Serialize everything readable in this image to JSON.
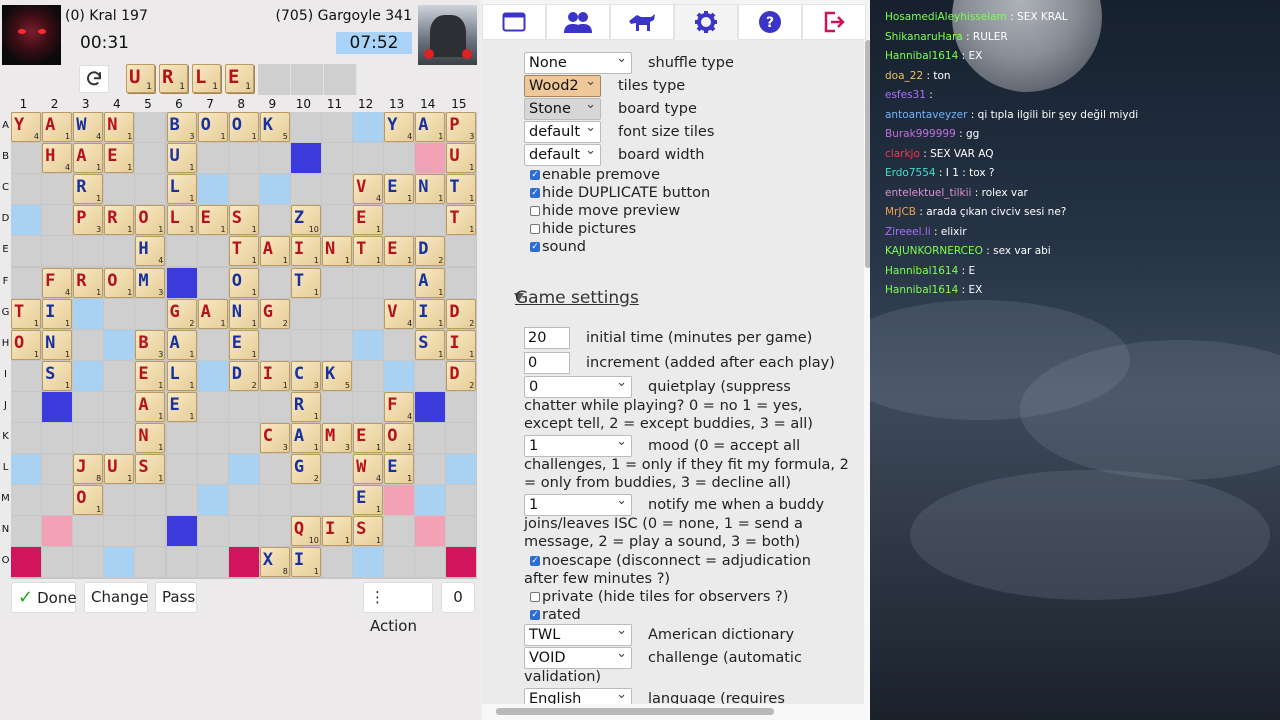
{
  "players": {
    "p1": {
      "name": "(0) Kral 197",
      "clock": "00:31"
    },
    "p2": {
      "name": "(705) Gargoyle 341",
      "clock": "07:52"
    }
  },
  "rack": [
    {
      "letter": "U",
      "value": "1"
    },
    {
      "letter": "R",
      "value": "1"
    },
    {
      "letter": "L",
      "value": "1"
    },
    {
      "letter": "E",
      "value": "1"
    }
  ],
  "board": {
    "columns": [
      "1",
      "2",
      "3",
      "4",
      "5",
      "6",
      "7",
      "8",
      "9",
      "10",
      "11",
      "12",
      "13",
      "14",
      "15"
    ],
    "rows": [
      "A",
      "B",
      "C",
      "D",
      "E",
      "F",
      "G",
      "H",
      "I",
      "J",
      "K",
      "L",
      "M",
      "N",
      "O"
    ],
    "tiles": [
      {
        "r": 0,
        "c": 0,
        "l": "Y",
        "v": "4"
      },
      {
        "r": 0,
        "c": 1,
        "l": "A",
        "v": "1"
      },
      {
        "r": 0,
        "c": 2,
        "l": "W",
        "v": "4",
        "b": true
      },
      {
        "r": 0,
        "c": 3,
        "l": "N",
        "v": "1"
      },
      {
        "r": 0,
        "c": 5,
        "l": "B",
        "v": "3",
        "b": true
      },
      {
        "r": 0,
        "c": 6,
        "l": "O",
        "v": "1",
        "b": true
      },
      {
        "r": 0,
        "c": 7,
        "l": "O",
        "v": "1",
        "b": true
      },
      {
        "r": 0,
        "c": 8,
        "l": "K",
        "v": "5",
        "b": true
      },
      {
        "r": 0,
        "c": 12,
        "l": "Y",
        "v": "4",
        "b": true
      },
      {
        "r": 0,
        "c": 13,
        "l": "A",
        "v": "1",
        "b": true
      },
      {
        "r": 0,
        "c": 14,
        "l": "P",
        "v": "3"
      },
      {
        "r": 1,
        "c": 1,
        "l": "H",
        "v": "4"
      },
      {
        "r": 1,
        "c": 2,
        "l": "A",
        "v": "1"
      },
      {
        "r": 1,
        "c": 3,
        "l": "E",
        "v": "1"
      },
      {
        "r": 1,
        "c": 5,
        "l": "U",
        "v": "1",
        "b": true
      },
      {
        "r": 1,
        "c": 14,
        "l": "U",
        "v": "1"
      },
      {
        "r": 2,
        "c": 2,
        "l": "R",
        "v": "1",
        "b": true
      },
      {
        "r": 2,
        "c": 5,
        "l": "L",
        "v": "1",
        "b": true
      },
      {
        "r": 2,
        "c": 11,
        "l": "V",
        "v": "4"
      },
      {
        "r": 2,
        "c": 12,
        "l": "E",
        "v": "1",
        "b": true
      },
      {
        "r": 2,
        "c": 13,
        "l": "N",
        "v": "1",
        "b": true
      },
      {
        "r": 2,
        "c": 14,
        "l": "T",
        "v": "1",
        "b": true
      },
      {
        "r": 3,
        "c": 2,
        "l": "P",
        "v": "3"
      },
      {
        "r": 3,
        "c": 3,
        "l": "R",
        "v": "1"
      },
      {
        "r": 3,
        "c": 4,
        "l": "O",
        "v": "1"
      },
      {
        "r": 3,
        "c": 5,
        "l": "L",
        "v": "1"
      },
      {
        "r": 3,
        "c": 6,
        "l": "E",
        "v": "1"
      },
      {
        "r": 3,
        "c": 7,
        "l": "S",
        "v": "1"
      },
      {
        "r": 3,
        "c": 9,
        "l": "Z",
        "v": "10",
        "b": true
      },
      {
        "r": 3,
        "c": 11,
        "l": "E",
        "v": "1"
      },
      {
        "r": 3,
        "c": 14,
        "l": "T",
        "v": "1"
      },
      {
        "r": 4,
        "c": 4,
        "l": "H",
        "v": "4",
        "b": true
      },
      {
        "r": 4,
        "c": 7,
        "l": "T",
        "v": "1"
      },
      {
        "r": 4,
        "c": 8,
        "l": "A",
        "v": "1"
      },
      {
        "r": 4,
        "c": 9,
        "l": "I",
        "v": "1"
      },
      {
        "r": 4,
        "c": 10,
        "l": "N",
        "v": "1"
      },
      {
        "r": 4,
        "c": 11,
        "l": "T",
        "v": "1"
      },
      {
        "r": 4,
        "c": 12,
        "l": "E",
        "v": "1"
      },
      {
        "r": 4,
        "c": 13,
        "l": "D",
        "v": "2",
        "b": true
      },
      {
        "r": 5,
        "c": 1,
        "l": "F",
        "v": "4"
      },
      {
        "r": 5,
        "c": 2,
        "l": "R",
        "v": "1"
      },
      {
        "r": 5,
        "c": 3,
        "l": "O",
        "v": "1"
      },
      {
        "r": 5,
        "c": 4,
        "l": "M",
        "v": "3",
        "b": true
      },
      {
        "r": 5,
        "c": 7,
        "l": "O",
        "v": "1",
        "b": true
      },
      {
        "r": 5,
        "c": 9,
        "l": "T",
        "v": "1",
        "b": true
      },
      {
        "r": 5,
        "c": 13,
        "l": "A",
        "v": "1",
        "b": true
      },
      {
        "r": 6,
        "c": 0,
        "l": "T",
        "v": "1"
      },
      {
        "r": 6,
        "c": 1,
        "l": "I",
        "v": "1",
        "b": true
      },
      {
        "r": 6,
        "c": 5,
        "l": "G",
        "v": "2"
      },
      {
        "r": 6,
        "c": 6,
        "l": "A",
        "v": "1"
      },
      {
        "r": 6,
        "c": 7,
        "l": "N",
        "v": "1",
        "b": true
      },
      {
        "r": 6,
        "c": 8,
        "l": "G",
        "v": "2"
      },
      {
        "r": 6,
        "c": 12,
        "l": "V",
        "v": "4"
      },
      {
        "r": 6,
        "c": 13,
        "l": "I",
        "v": "1",
        "b": true
      },
      {
        "r": 6,
        "c": 14,
        "l": "D",
        "v": "2"
      },
      {
        "r": 7,
        "c": 0,
        "l": "O",
        "v": "1"
      },
      {
        "r": 7,
        "c": 1,
        "l": "N",
        "v": "1",
        "b": true
      },
      {
        "r": 7,
        "c": 4,
        "l": "B",
        "v": "3"
      },
      {
        "r": 7,
        "c": 5,
        "l": "A",
        "v": "1",
        "b": true
      },
      {
        "r": 7,
        "c": 7,
        "l": "E",
        "v": "1",
        "b": true
      },
      {
        "r": 7,
        "c": 13,
        "l": "S",
        "v": "1",
        "b": true
      },
      {
        "r": 7,
        "c": 14,
        "l": "I",
        "v": "1"
      },
      {
        "r": 8,
        "c": 1,
        "l": "S",
        "v": "1",
        "b": true
      },
      {
        "r": 8,
        "c": 4,
        "l": "E",
        "v": "1"
      },
      {
        "r": 8,
        "c": 5,
        "l": "L",
        "v": "1",
        "b": true
      },
      {
        "r": 8,
        "c": 7,
        "l": "D",
        "v": "2",
        "b": true
      },
      {
        "r": 8,
        "c": 8,
        "l": "I",
        "v": "1"
      },
      {
        "r": 8,
        "c": 9,
        "l": "C",
        "v": "3",
        "b": true
      },
      {
        "r": 8,
        "c": 10,
        "l": "K",
        "v": "5",
        "b": true
      },
      {
        "r": 8,
        "c": 14,
        "l": "D",
        "v": "2"
      },
      {
        "r": 9,
        "c": 4,
        "l": "A",
        "v": "1"
      },
      {
        "r": 9,
        "c": 5,
        "l": "E",
        "v": "1",
        "b": true
      },
      {
        "r": 9,
        "c": 9,
        "l": "R",
        "v": "1",
        "b": true
      },
      {
        "r": 9,
        "c": 12,
        "l": "F",
        "v": "4"
      },
      {
        "r": 10,
        "c": 4,
        "l": "N",
        "v": "1"
      },
      {
        "r": 10,
        "c": 8,
        "l": "C",
        "v": "3"
      },
      {
        "r": 10,
        "c": 9,
        "l": "A",
        "v": "1",
        "b": true
      },
      {
        "r": 10,
        "c": 10,
        "l": "M",
        "v": "3"
      },
      {
        "r": 10,
        "c": 11,
        "l": "E",
        "v": "1"
      },
      {
        "r": 10,
        "c": 12,
        "l": "O",
        "v": "1"
      },
      {
        "r": 11,
        "c": 2,
        "l": "J",
        "v": "8"
      },
      {
        "r": 11,
        "c": 3,
        "l": "U",
        "v": "1"
      },
      {
        "r": 11,
        "c": 4,
        "l": "S",
        "v": "1"
      },
      {
        "r": 11,
        "c": 9,
        "l": "G",
        "v": "2",
        "b": true
      },
      {
        "r": 11,
        "c": 11,
        "l": "W",
        "v": "4"
      },
      {
        "r": 11,
        "c": 12,
        "l": "E",
        "v": "1",
        "b": true
      },
      {
        "r": 12,
        "c": 2,
        "l": "O",
        "v": "1"
      },
      {
        "r": 12,
        "c": 11,
        "l": "E",
        "v": "1",
        "b": true
      },
      {
        "r": 13,
        "c": 9,
        "l": "Q",
        "v": "10"
      },
      {
        "r": 13,
        "c": 10,
        "l": "I",
        "v": "1"
      },
      {
        "r": 13,
        "c": 11,
        "l": "S",
        "v": "1"
      },
      {
        "r": 14,
        "c": 8,
        "l": "X",
        "v": "8",
        "b": true
      },
      {
        "r": 14,
        "c": 9,
        "l": "I",
        "v": "1",
        "b": true
      }
    ]
  },
  "buttons": {
    "done": "Done",
    "change": "Change",
    "pass": "Pass",
    "action": "Action",
    "bag": "0"
  },
  "settings": {
    "shuffle": {
      "value": "None",
      "label": "shuffle type"
    },
    "tiles": {
      "value": "Wood2",
      "label": "tiles type"
    },
    "board": {
      "value": "Stone",
      "label": "board type"
    },
    "font": {
      "value": "default",
      "label": "font size tiles"
    },
    "width": {
      "value": "default",
      "label": "board width"
    },
    "premove": "enable premove",
    "duplicate": "hide DUPLICATE button",
    "movepreview": "hide move preview",
    "pictures": "hide pictures",
    "sound": "sound",
    "game_heading": "Game settings",
    "initial_time": {
      "value": "20",
      "label": "initial time (minutes per game)"
    },
    "increment": {
      "value": "0",
      "label": "increment (added after each play)"
    },
    "quietplay": {
      "value": "0",
      "label1": "quietplay (suppress",
      "label2": "chatter while playing? 0 = no 1 = yes,",
      "label3": "except tell, 2 = except buddies, 3 = all)"
    },
    "mood": {
      "value": "1",
      "label1": "mood (0 = accept all",
      "label2": "challenges, 1 = only if they fit my formula, 2",
      "label3": "= only from buddies, 3 = decline all)"
    },
    "notify": {
      "value": "1",
      "label1": "notify me when a buddy",
      "label2": "joins/leaves ISC (0 = none, 1 = send a",
      "label3": "message, 2 = play a sound, 3 = both)"
    },
    "noescape1": "noescape (disconnect = adjudication",
    "noescape2": "after few minutes ?)",
    "private": "private (hide tiles for observers ?)",
    "rated": "rated",
    "dictionary": {
      "value": "TWL",
      "label": "American dictionary"
    },
    "challenge": {
      "value": "VOID",
      "label1": "challenge (automatic",
      "label2": "validation)"
    },
    "language": {
      "value": "English",
      "label": "language (requires"
    }
  },
  "chat": [
    {
      "name": "HosamediAleyhisselam",
      "text": ": SEX KRAL",
      "color": "#7cff4f"
    },
    {
      "name": "ShikanaruHara",
      "text": ": RULER",
      "color": "#7cff4f"
    },
    {
      "name": "Hannibal1614",
      "text": ": EX",
      "color": "#7cff4f"
    },
    {
      "name": "doa_22",
      "text": ": ton",
      "color": "#f0c060"
    },
    {
      "name": "esfes31",
      "text": ":",
      "color": "#b06cff"
    },
    {
      "name": "antoantaveyzer",
      "text": ": qi tıpla ilgili bir şey değil miydi",
      "color": "#6fb4ff"
    },
    {
      "name": "Burak999999",
      "text": ": gg",
      "color": "#c070e0"
    },
    {
      "name": "clarkjo",
      "text": ": SEX VAR AQ",
      "color": "#ff3050"
    },
    {
      "name": "Erdo7554",
      "text": ": I 1 : tox ?",
      "color": "#40e0d0"
    },
    {
      "name": "entelektuel_tilkii",
      "text": ": rolex var",
      "color": "#e090d0"
    },
    {
      "name": "MrJCB",
      "text": ": arada çıkan civciv sesi ne?",
      "color": "#f0a050"
    },
    {
      "name": "Zireeel.li",
      "text": ": elixir",
      "color": "#b06cff"
    },
    {
      "name": "KAJUNKORNERCEO",
      "text": ": sex var abi",
      "color": "#7cff4f"
    },
    {
      "name": "Hannibal1614",
      "text": ": E",
      "color": "#7cff4f"
    },
    {
      "name": "Hannibal1614",
      "text": ": EX",
      "color": "#7cff4f"
    }
  ],
  "colors": {
    "tile_letter": "#b5121b",
    "blank_letter": "#18319f",
    "clock_active": "#a9d4f7",
    "accent": "#2b6fd6"
  }
}
